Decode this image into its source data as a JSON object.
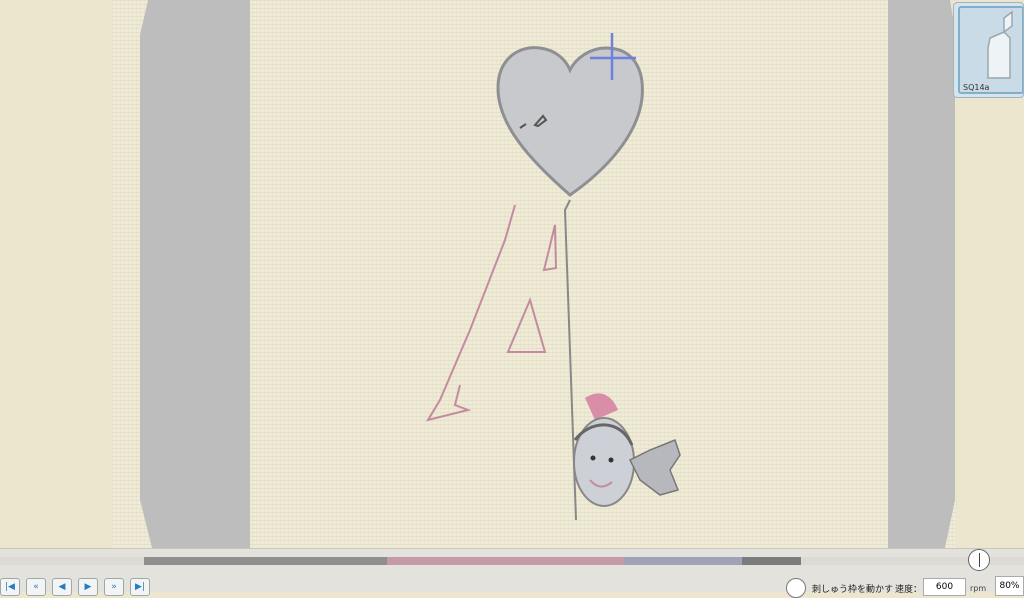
{
  "thumbnail": {
    "label": "SQ14a",
    "icon": "bottle-outline-icon"
  },
  "color_sequence": [
    {
      "color": "#8f8f8f",
      "fraction": 0.37
    },
    {
      "color": "#c49aa6",
      "fraction": 0.36
    },
    {
      "color": "#9fa3b5",
      "fraction": 0.18
    },
    {
      "color": "#7c7c7c",
      "fraction": 0.09
    }
  ],
  "progress": {
    "fraction": 1.0
  },
  "nav": [
    "|◀",
    "«",
    "◀",
    "▶",
    "»",
    "▶|"
  ],
  "controls": {
    "move_label": "刺しゅう枠を動かす",
    "speed_label": "速度：",
    "speed_value": "600",
    "speed_unit": "rpm",
    "zoom_value": "80%"
  },
  "colors": {
    "fabric": "#efebd7",
    "hoop": "#bdbdbd",
    "heart_fill": "#c8c9cc",
    "pink_thread": "#c48ba0",
    "cursor": "#7080e0"
  }
}
